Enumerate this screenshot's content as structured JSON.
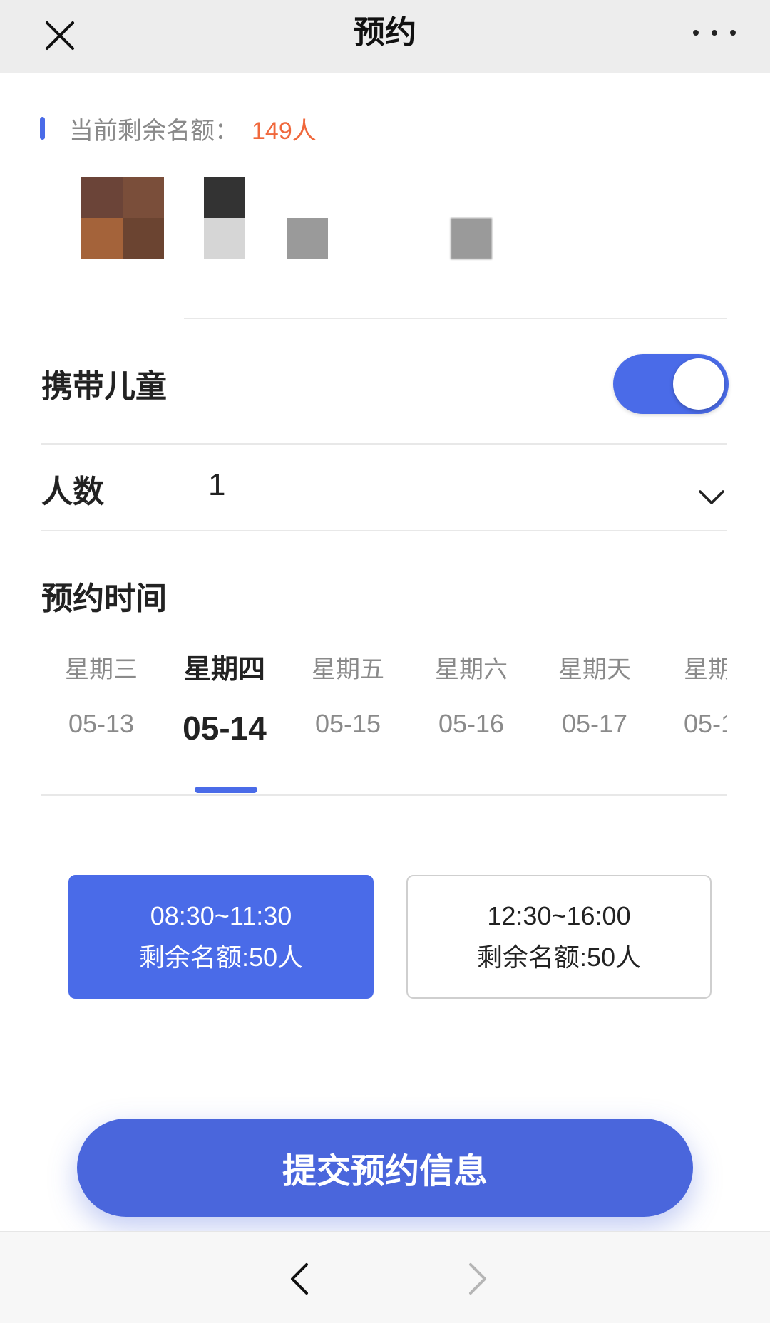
{
  "nav": {
    "title": "预约",
    "close_icon": "close-icon",
    "more_icon": "more-dots-icon"
  },
  "quota": {
    "label": "当前剩余名额：",
    "value": "149人",
    "value_color": "#f0683c",
    "accent": "#4a6be8"
  },
  "image_row": {
    "note": "pixelated / blurred content"
  },
  "children": {
    "label": "携带儿童",
    "toggle_on": true
  },
  "people": {
    "label": "人数",
    "value": "1",
    "dropdown_icon": "chevron-down-icon"
  },
  "schedule": {
    "label": "预约时间",
    "days": [
      {
        "weekday": "星期三",
        "date": "05-13",
        "active": false
      },
      {
        "weekday": "星期四",
        "date": "05-14",
        "active": true
      },
      {
        "weekday": "星期五",
        "date": "05-15",
        "active": false
      },
      {
        "weekday": "星期六",
        "date": "05-16",
        "active": false
      },
      {
        "weekday": "星期天",
        "date": "05-17",
        "active": false
      },
      {
        "weekday": "星期",
        "date": "05-1",
        "active": false
      }
    ]
  },
  "slots": [
    {
      "time": "08:30~11:30",
      "remain": "剩余名额:50人",
      "selected": true
    },
    {
      "time": "12:30~16:00",
      "remain": "剩余名额:50人",
      "selected": false
    }
  ],
  "submit": {
    "label": "提交预约信息",
    "color": "#4a66dc"
  },
  "bottom_nav": {
    "back_icon": "chevron-left-icon",
    "forward_icon": "chevron-right-icon"
  }
}
